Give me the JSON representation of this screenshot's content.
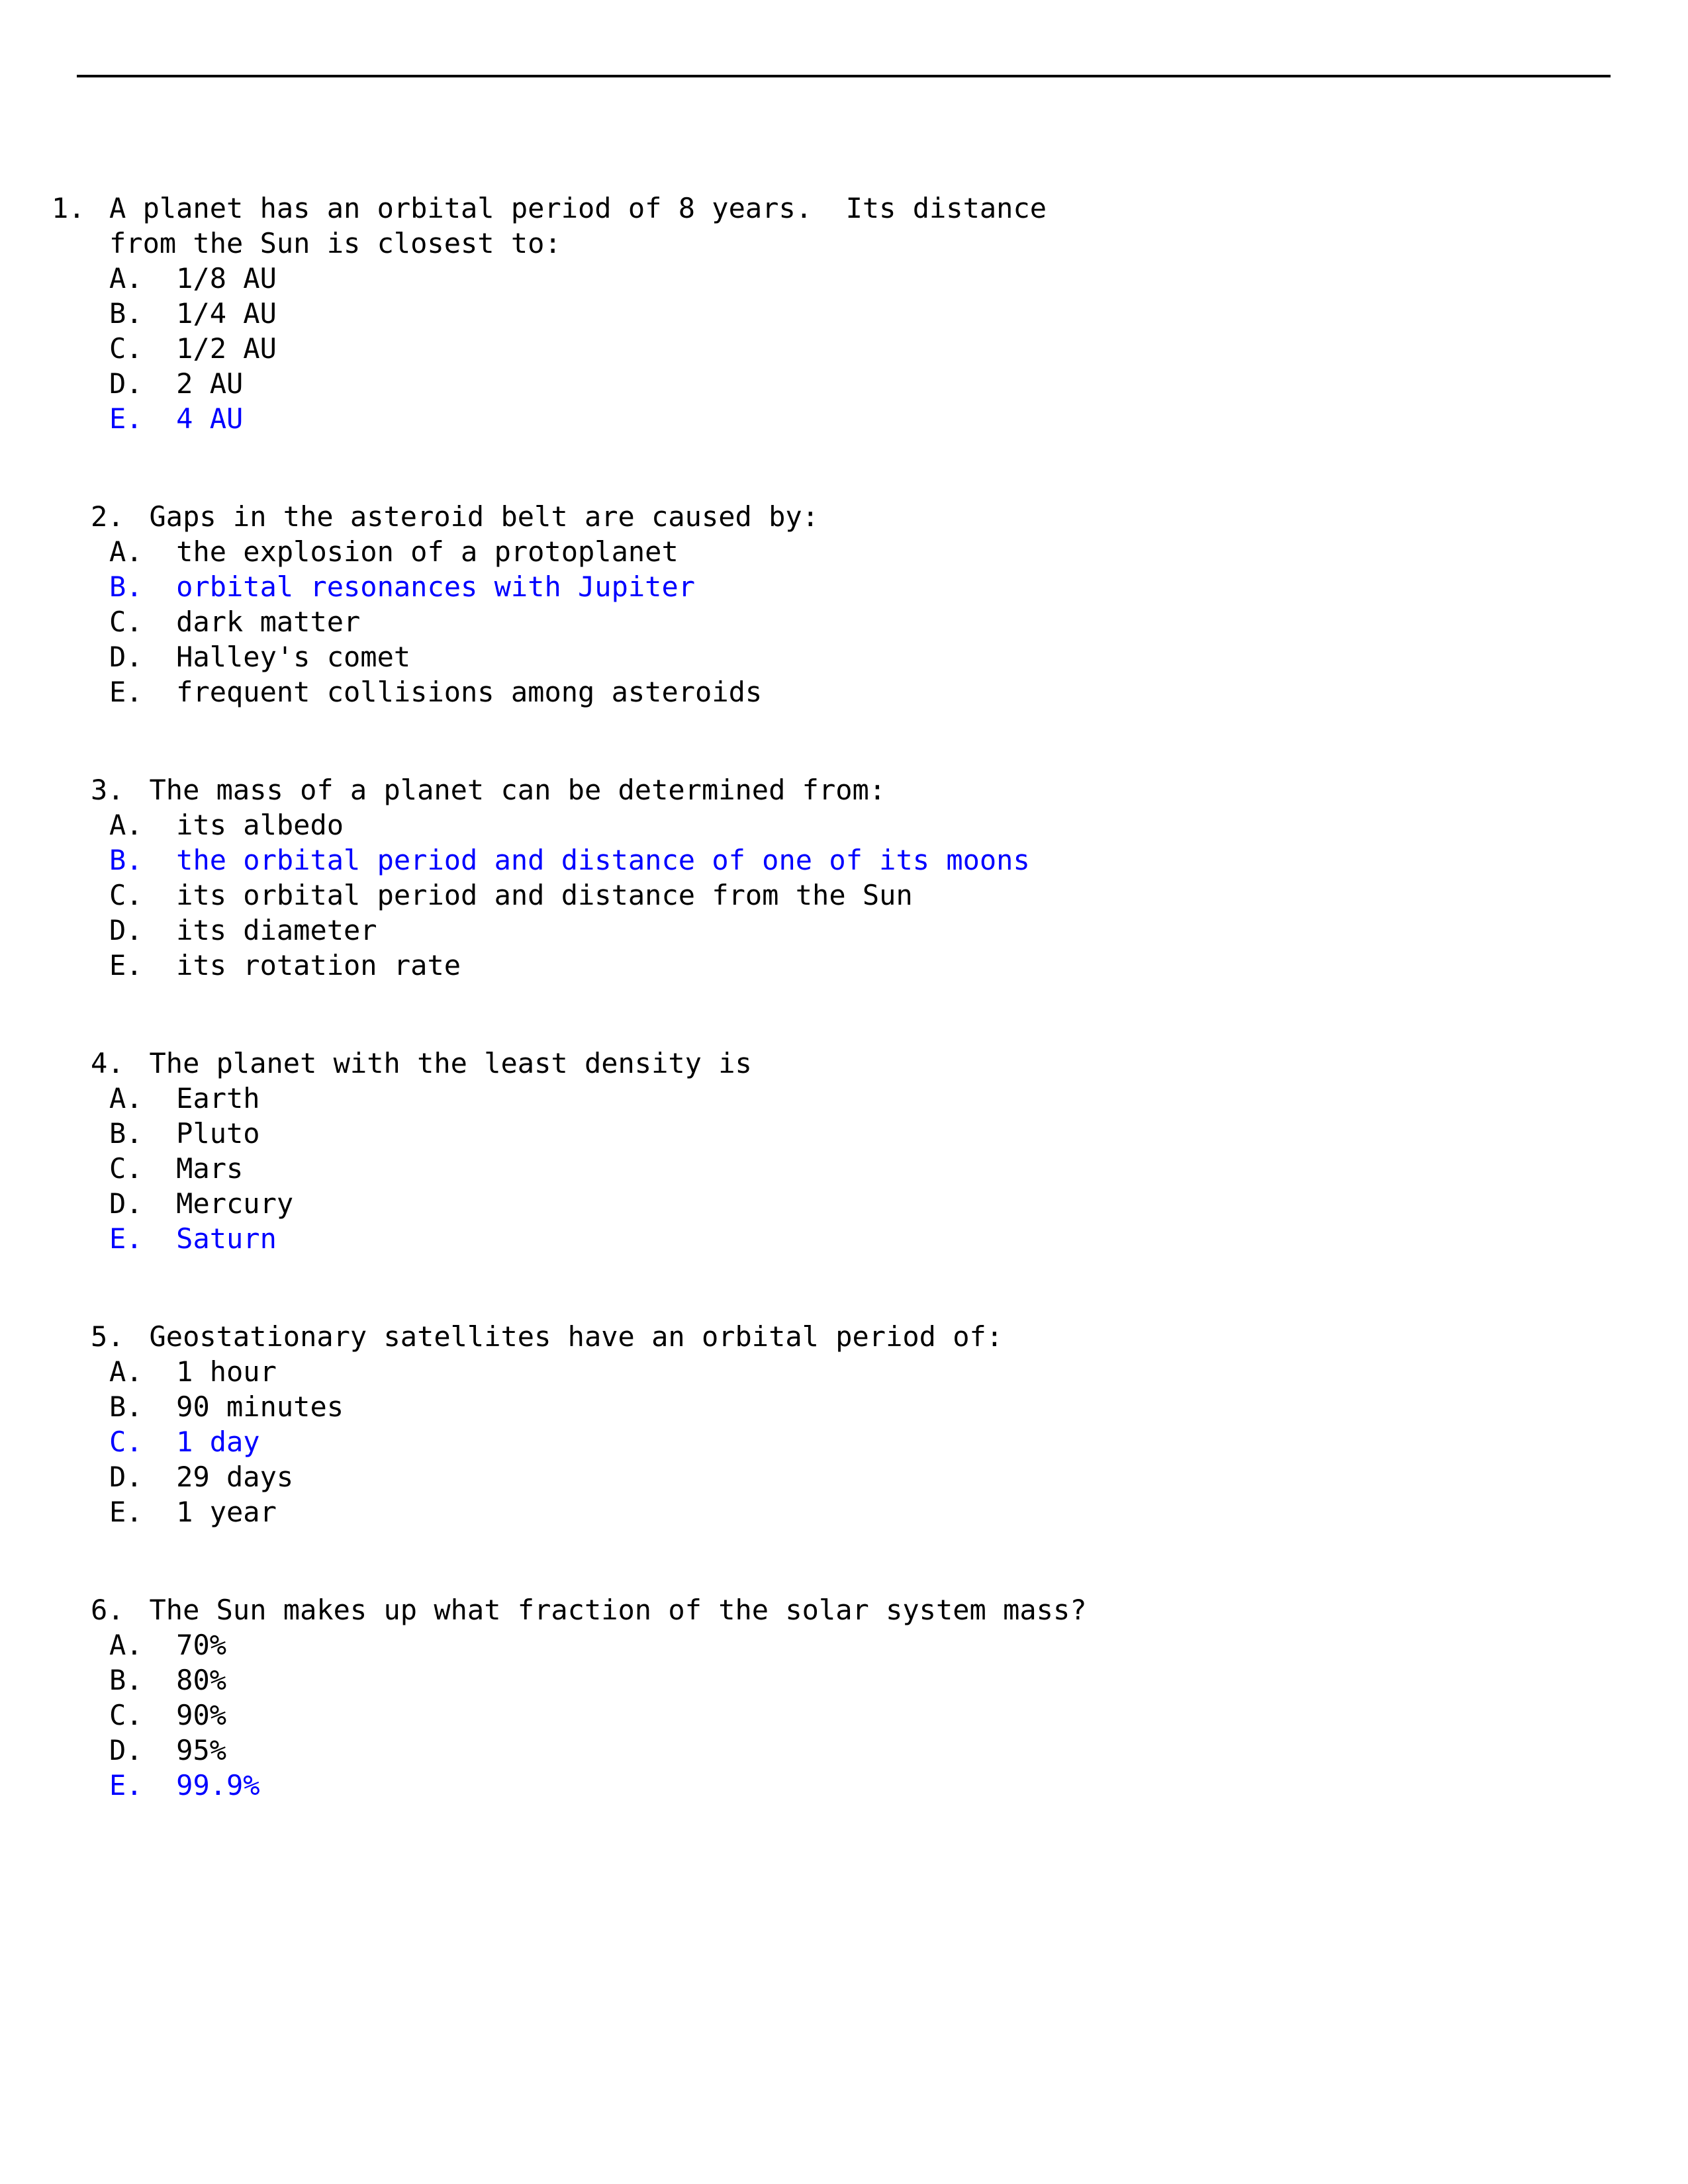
{
  "document": {
    "type": "multiple-choice-quiz",
    "header_rule": true,
    "answer_highlight_color": "#0000FF",
    "body_text_color": "#000000",
    "background_color": "#FFFFFF"
  },
  "questions": [
    {
      "number": "1.",
      "prompt_lines": [
        "A planet has an orbital period of 8 years.  Its distance",
        "from the Sun is closest to:"
      ],
      "options": [
        {
          "letter": "A.",
          "text": "1/8 AU",
          "correct": false
        },
        {
          "letter": "B.",
          "text": "1/4 AU",
          "correct": false
        },
        {
          "letter": "C.",
          "text": "1/2 AU",
          "correct": false
        },
        {
          "letter": "D.",
          "text": "2 AU",
          "correct": false
        },
        {
          "letter": "E.",
          "text": "4 AU",
          "correct": true
        }
      ]
    },
    {
      "number": "2.",
      "prompt_lines": [
        "Gaps in the asteroid belt are caused by:"
      ],
      "options": [
        {
          "letter": "A.",
          "text": "the explosion of a protoplanet",
          "correct": false
        },
        {
          "letter": "B.",
          "text": "orbital resonances with Jupiter",
          "correct": true
        },
        {
          "letter": "C.",
          "text": "dark matter",
          "correct": false
        },
        {
          "letter": "D.",
          "text": "Halley's comet",
          "correct": false
        },
        {
          "letter": "E.",
          "text": "frequent collisions among asteroids",
          "correct": false
        }
      ]
    },
    {
      "number": "3.",
      "prompt_lines": [
        "The mass of a planet can be determined from:"
      ],
      "options": [
        {
          "letter": "A.",
          "text": "its albedo",
          "correct": false
        },
        {
          "letter": "B.",
          "text": "the orbital period and distance of one of its moons",
          "correct": true
        },
        {
          "letter": "C.",
          "text": "its orbital period and distance from the Sun",
          "correct": false
        },
        {
          "letter": "D.",
          "text": "its diameter",
          "correct": false
        },
        {
          "letter": "E.",
          "text": "its rotation rate",
          "correct": false
        }
      ]
    },
    {
      "number": "4.",
      "prompt_lines": [
        "The planet with the least density is"
      ],
      "options": [
        {
          "letter": "A.",
          "text": "Earth",
          "correct": false
        },
        {
          "letter": "B.",
          "text": "Pluto",
          "correct": false
        },
        {
          "letter": "C.",
          "text": "Mars",
          "correct": false
        },
        {
          "letter": "D.",
          "text": "Mercury",
          "correct": false
        },
        {
          "letter": "E.",
          "text": "Saturn",
          "correct": true
        }
      ]
    },
    {
      "number": "5.",
      "prompt_lines": [
        "Geostationary satellites have an orbital period of:"
      ],
      "options": [
        {
          "letter": "A.",
          "text": "1 hour",
          "correct": false
        },
        {
          "letter": "B.",
          "text": "90 minutes",
          "correct": false
        },
        {
          "letter": "C.",
          "text": "1 day",
          "correct": true
        },
        {
          "letter": "D.",
          "text": "29 days",
          "correct": false
        },
        {
          "letter": "E.",
          "text": "1 year",
          "correct": false
        }
      ]
    },
    {
      "number": "6.",
      "prompt_lines": [
        "The Sun makes up what fraction of the solar system mass?"
      ],
      "options": [
        {
          "letter": "A.",
          "text": "70%",
          "correct": false
        },
        {
          "letter": "B.",
          "text": "80%",
          "correct": false
        },
        {
          "letter": "C.",
          "text": "90%",
          "correct": false
        },
        {
          "letter": "D.",
          "text": "95%",
          "correct": false
        },
        {
          "letter": "E.",
          "text": "99.9%",
          "correct": true
        }
      ]
    }
  ]
}
